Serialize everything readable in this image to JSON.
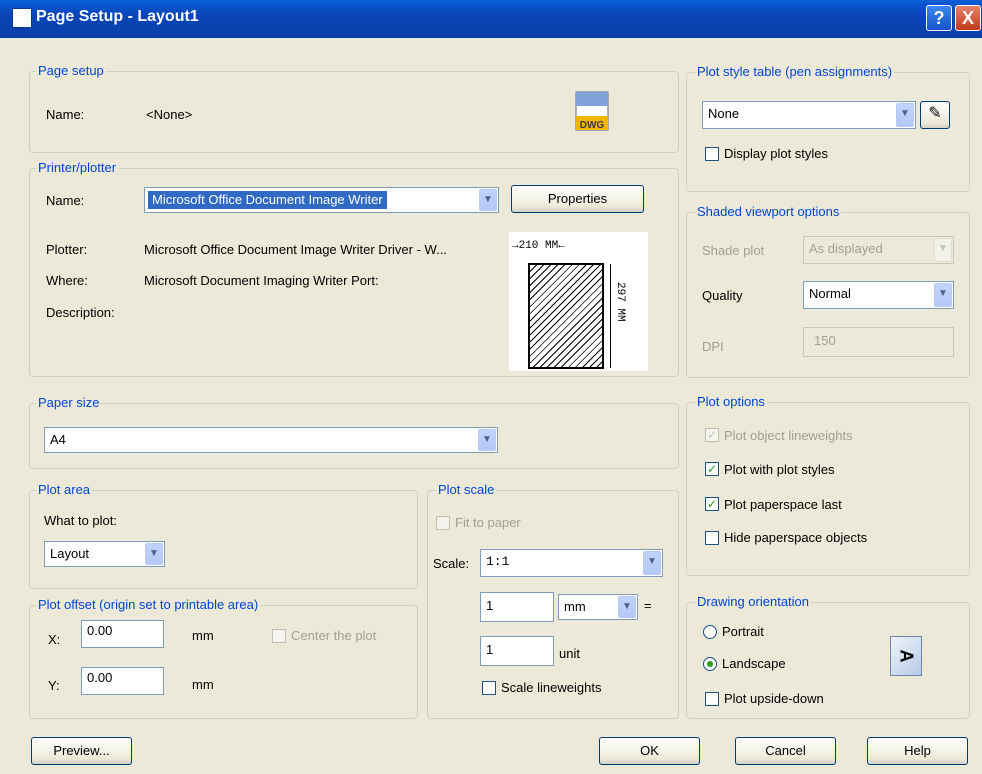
{
  "window": {
    "title": "Page Setup - Layout1",
    "help": "?",
    "close": "X"
  },
  "page_setup": {
    "legend": "Page setup",
    "name_label": "Name:",
    "name_value": "<None>",
    "icon": "DWG"
  },
  "printer": {
    "legend": "Printer/plotter",
    "name_label": "Name:",
    "name_value": "Microsoft Office Document Image Writer",
    "properties": "Properties",
    "plotter_label": "Plotter:",
    "plotter_value": "Microsoft Office Document Image Writer Driver - W...",
    "where_label": "Where:",
    "where_value": "Microsoft Document Imaging Writer Port:",
    "description_label": "Description:",
    "preview_width": "210 MM",
    "preview_height": "297 MM"
  },
  "paper_size": {
    "legend": "Paper size",
    "value": "A4"
  },
  "plot_area": {
    "legend": "Plot area",
    "what_label": "What to plot:",
    "value": "Layout"
  },
  "plot_scale": {
    "legend": "Plot scale",
    "fit": "Fit to paper",
    "scale_label": "Scale:",
    "scale_value": "1:1",
    "num": "1",
    "unit_select": "mm",
    "equals": "=",
    "den": "1",
    "unit_label": "unit",
    "lineweights": "Scale lineweights"
  },
  "plot_offset": {
    "legend": "Plot offset (origin set to printable area)",
    "x_label": "X:",
    "x_value": "0.00",
    "y_label": "Y:",
    "y_value": "0.00",
    "unit": "mm",
    "center": "Center the plot"
  },
  "plot_style": {
    "legend": "Plot style table (pen assignments)",
    "value": "None",
    "display": "Display plot styles"
  },
  "shaded": {
    "legend": "Shaded viewport options",
    "shade_label": "Shade plot",
    "shade_value": "As displayed",
    "quality_label": "Quality",
    "quality_value": "Normal",
    "dpi_label": "DPI",
    "dpi_value": "150"
  },
  "plot_options": {
    "legend": "Plot options",
    "lineweights": "Plot object lineweights",
    "with_styles": "Plot with plot styles",
    "paperspace_last": "Plot paperspace last",
    "hide": "Hide paperspace objects"
  },
  "orientation": {
    "legend": "Drawing orientation",
    "portrait": "Portrait",
    "landscape": "Landscape",
    "upside": "Plot upside-down",
    "icon": "A"
  },
  "buttons": {
    "preview": "Preview...",
    "ok": "OK",
    "cancel": "Cancel",
    "help": "Help"
  }
}
